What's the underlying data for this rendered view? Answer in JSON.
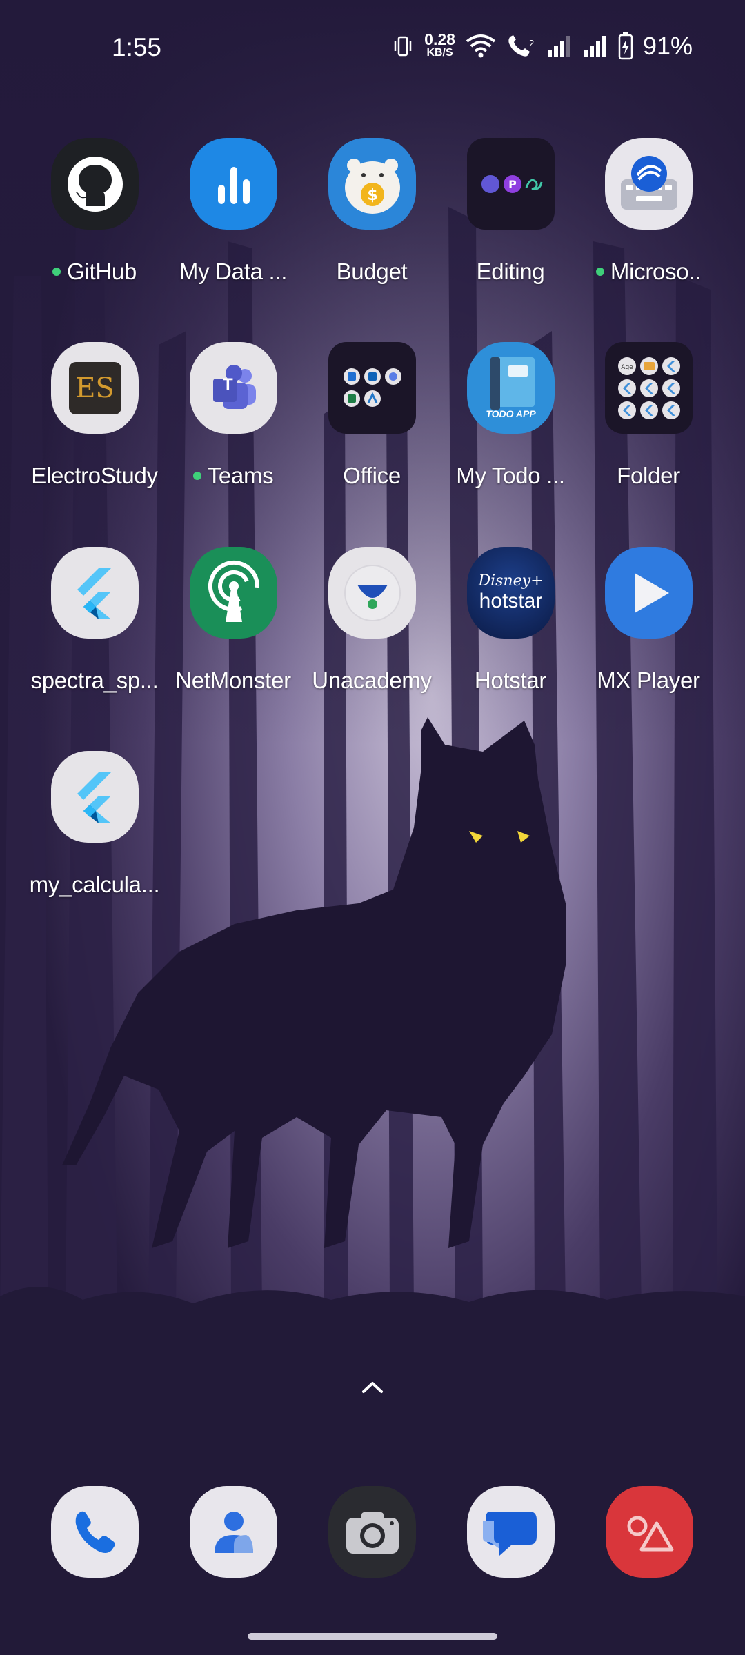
{
  "status": {
    "time": "1:55",
    "net_speed_value": "0.28",
    "net_speed_unit": "KB/S",
    "battery": "91%",
    "icons": [
      "vibrate-icon",
      "wifi-icon",
      "volte-call-icon",
      "signal-sim1-icon",
      "signal-sim2-icon",
      "battery-charging-icon"
    ]
  },
  "apps": [
    {
      "label": "GitHub",
      "dot": true,
      "icon": "github-icon"
    },
    {
      "label": "My Data ...",
      "dot": false,
      "icon": "bar-chart-icon"
    },
    {
      "label": "Budget",
      "dot": false,
      "icon": "piggy-bank-icon"
    },
    {
      "label": "Editing",
      "dot": false,
      "icon": "folder-icon"
    },
    {
      "label": "Microso..",
      "dot": true,
      "icon": "swiftkey-keyboard-icon"
    },
    {
      "label": "ElectroStudy",
      "dot": false,
      "icon": "es-logo-icon",
      "icon_text": "ES"
    },
    {
      "label": "Teams",
      "dot": true,
      "icon": "teams-icon",
      "icon_text": "T"
    },
    {
      "label": "Office",
      "dot": false,
      "icon": "folder-icon"
    },
    {
      "label": "My Todo ...",
      "dot": false,
      "icon": "book-icon",
      "icon_text": "TODO APP"
    },
    {
      "label": "Folder",
      "dot": false,
      "icon": "folder-icon",
      "icon_text": "Age"
    },
    {
      "label": "spectra_sp...",
      "dot": false,
      "icon": "flutter-icon"
    },
    {
      "label": "NetMonster",
      "dot": false,
      "icon": "antenna-icon"
    },
    {
      "label": "Unacademy",
      "dot": false,
      "icon": "unacademy-icon"
    },
    {
      "label": "Hotstar",
      "dot": false,
      "icon": "hotstar-icon",
      "icon_text": "Disney+",
      "icon_text2": "hotstar"
    },
    {
      "label": "MX Player",
      "dot": false,
      "icon": "play-icon"
    },
    {
      "label": "my_calcula...",
      "dot": false,
      "icon": "flutter-icon"
    }
  ],
  "dock": [
    "phone-icon",
    "contacts-icon",
    "camera-icon",
    "messages-icon",
    "gallery-icon"
  ],
  "colors": {
    "dot": "#3fd07a",
    "background": "#221a38"
  }
}
